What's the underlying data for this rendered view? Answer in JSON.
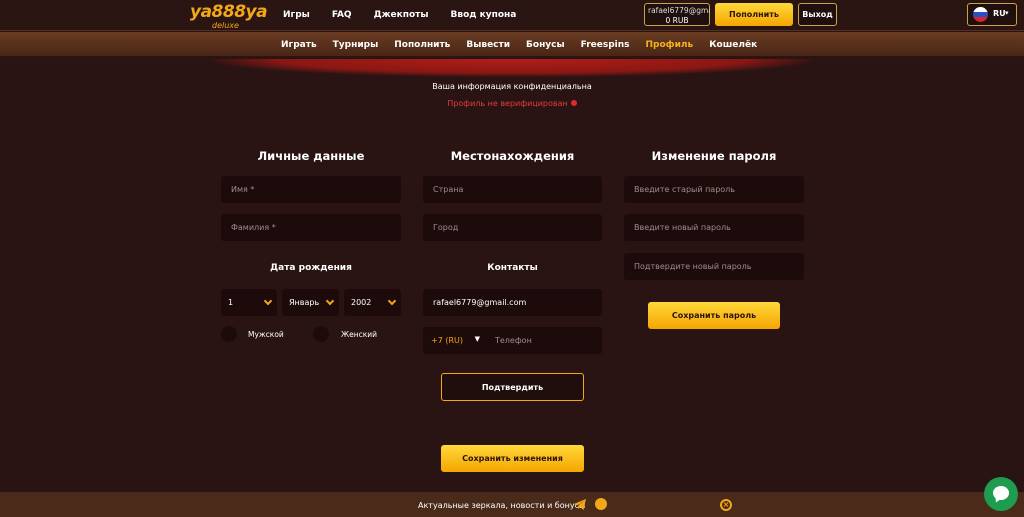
{
  "brand": {
    "logo_main": "ya888ya",
    "logo_sub": "deluxe"
  },
  "topnav": {
    "games": "Игры",
    "faq": "FAQ",
    "jackpots": "Джекпоты",
    "coupon": "Ввод купона"
  },
  "account": {
    "email": "rafael6779@gmail.com",
    "balance": "0 RUB",
    "deposit": "Пополнить",
    "logout": "Выход"
  },
  "language": {
    "code": "RU",
    "flag": "russia-flag"
  },
  "subnav": {
    "items": [
      "Играть",
      "Турниры",
      "Пополнить",
      "Вывести",
      "Бонусы",
      "Freespins",
      "Профиль",
      "Кошелёк"
    ],
    "active": "Профиль"
  },
  "notice": {
    "privacy": "Ваша информация конфиденциальна",
    "status": "Профиль не верифицирован"
  },
  "personal": {
    "title": "Личные данные",
    "first_name_placeholder": "Имя *",
    "last_name_placeholder": "Фамилия *",
    "dob_title": "Дата рождения",
    "dob_day": "1",
    "dob_month": "Январь",
    "dob_year": "2002",
    "gender_male": "Мужской",
    "gender_female": "Женский"
  },
  "location": {
    "title": "Местонахождения",
    "country_placeholder": "Страна",
    "city_placeholder": "Город",
    "contacts_title": "Контакты",
    "email_value": "rafael6779@gmail.com",
    "phone_code": "+7 (RU)",
    "phone_placeholder": "Телефон",
    "confirm_button": "Подтвердить"
  },
  "password": {
    "title": "Изменение пароля",
    "old_placeholder": "Введите старый пароль",
    "new_placeholder": "Введите новый пароль",
    "confirm_placeholder": "Подтвердите новый пароль",
    "save_button": "Сохранить пароль"
  },
  "save_changes": "Сохранить изменения",
  "footer": {
    "text": "Актуальные зеркала, новости и бонусы"
  },
  "colors": {
    "accent": "#f3a817",
    "background": "#2a1413",
    "field": "#1c0b0a",
    "error": "#e23b3b",
    "chat": "#1e9c4f"
  }
}
